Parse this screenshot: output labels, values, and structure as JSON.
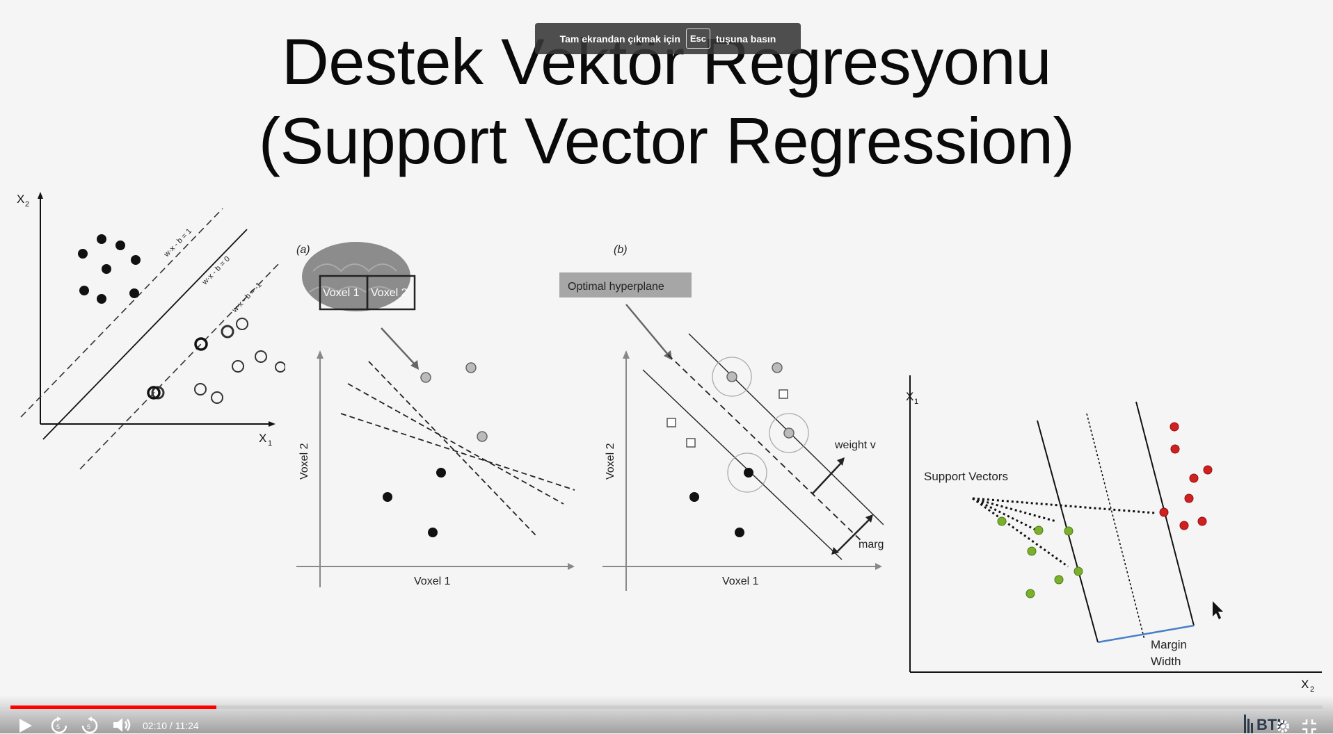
{
  "slide": {
    "title_line1": "Destek Vektör Regresyonu",
    "title_line2": "(Support Vector Regression)"
  },
  "fullscreen_toast": {
    "text_before": "Tam ekrandan çıkmak için",
    "key": "Esc",
    "text_after": "tuşuna basın"
  },
  "figure1": {
    "y_axis_label": "X",
    "y_axis_sub": "2",
    "x_axis_label": "X",
    "x_axis_sub": "1",
    "line_label_top": "w·x - b = 1",
    "line_label_mid": "w·x - b = 0",
    "line_label_bot": "w·x - b = -1"
  },
  "figure2": {
    "panel_label": "(a)",
    "voxel1": "Voxel 1",
    "voxel2": "Voxel 2",
    "y_axis_label": "Voxel 2",
    "x_axis_label": "Voxel 1"
  },
  "figure3": {
    "panel_label": "(b)",
    "hyperplane_label": "Optimal hyperplane",
    "weight_label": "weight v",
    "margin_label": "marg",
    "y_axis_label": "Voxel 2",
    "x_axis_label": "Voxel 1"
  },
  "figure4": {
    "y_axis_label": "X",
    "y_axis_sub": "1",
    "x_axis_label": "X",
    "x_axis_sub": "2",
    "support_vectors_label": "Support Vectors",
    "margin_line1": "Margin",
    "margin_line2": "Width"
  },
  "player": {
    "time": "02:10 / 11:24",
    "progress": 0.157,
    "skip_back_seconds": "5",
    "skip_forward_seconds": "5",
    "brand": "BTK",
    "accent_color": "#ff0000"
  }
}
